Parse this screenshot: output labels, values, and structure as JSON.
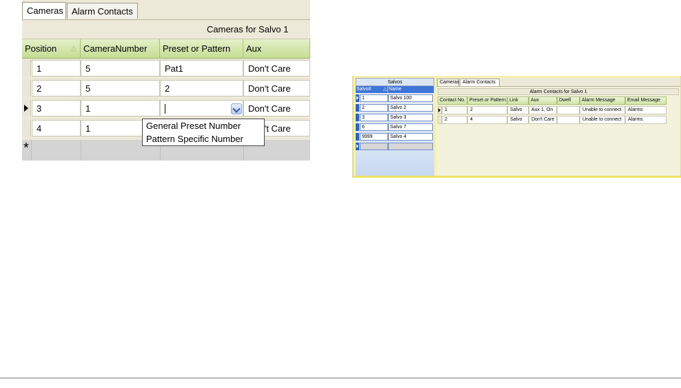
{
  "left_grid": {
    "tabs": [
      {
        "label": "Cameras",
        "active": true
      },
      {
        "label": "Alarm Contacts",
        "active": false
      }
    ],
    "caption": "Cameras for Salvo 1",
    "columns": [
      "Position",
      "CameraNumber",
      "Preset or Pattern",
      "Aux"
    ],
    "rows": [
      {
        "position": "1",
        "camera": "5",
        "preset": "Pat1",
        "aux": "Don't Care"
      },
      {
        "position": "2",
        "camera": "5",
        "preset": "2",
        "aux": "Don't Care"
      },
      {
        "position": "3",
        "camera": "1",
        "preset": "",
        "aux": "Don't Care"
      },
      {
        "position": "4",
        "camera": "1",
        "preset": "",
        "aux": "Don't Care"
      }
    ],
    "new_row_marker": "*",
    "dropdown_options": [
      "General Preset Number",
      "Pattern Specific Number"
    ]
  },
  "right_panel": {
    "salvos": {
      "title": "Salvos",
      "columns": [
        "Salvo#",
        "Name"
      ],
      "rows": [
        {
          "num": "1",
          "name": "Salvo 100"
        },
        {
          "num": "2",
          "name": "Salvo 2"
        },
        {
          "num": "3",
          "name": "Salvo 3"
        },
        {
          "num": "6",
          "name": "Salvo 7"
        },
        {
          "num": "9999",
          "name": "Salvo 4"
        }
      ]
    },
    "tabs": [
      {
        "label": "Cameras",
        "active": false
      },
      {
        "label": "Alarm Contacts",
        "active": true
      }
    ],
    "caption": "Alarm Contacts for Salvo 1",
    "columns": [
      "Contact No.",
      "Preset or Pattern",
      "Link",
      "Aux",
      "Dwell",
      "Alarm Message",
      "Email Message"
    ],
    "rows": [
      {
        "contact": "1",
        "preset": "2",
        "link": "Salvo",
        "aux": "Aux 1, On",
        "dwell": "",
        "alarm": "Unable to connect",
        "email": "Alarms"
      },
      {
        "contact": "2",
        "preset": "4",
        "link": "Salvo",
        "aux": "Don't Care",
        "dwell": "",
        "alarm": "Unable to connect",
        "email": "Alarms"
      }
    ]
  },
  "colors": {
    "header_green": "#c5dd93",
    "salvo_blue": "#3e75d9",
    "highlight_yellow": "#f4f2ae"
  }
}
